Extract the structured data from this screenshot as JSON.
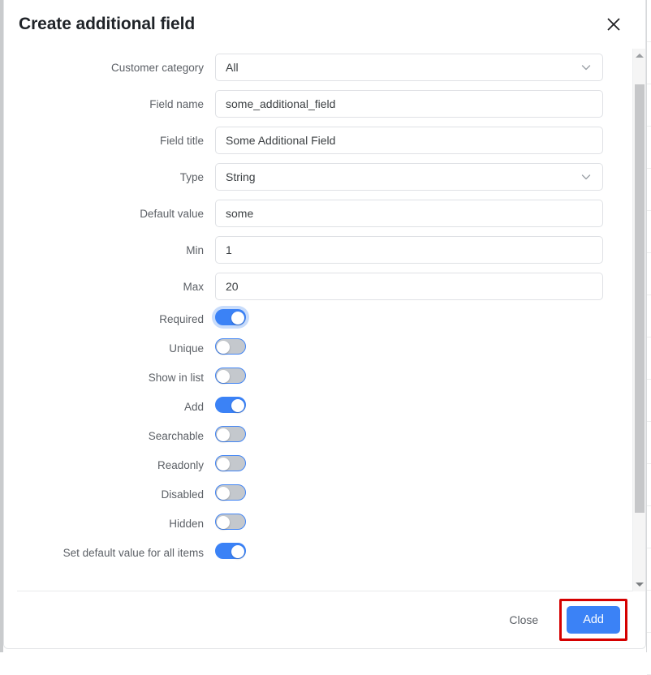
{
  "dialog": {
    "title": "Create additional field",
    "close_icon": "close-icon"
  },
  "form": {
    "rows": [
      {
        "label": "Customer category",
        "type": "select",
        "value": "All"
      },
      {
        "label": "Field name",
        "type": "text",
        "value": "some_additional_field"
      },
      {
        "label": "Field title",
        "type": "text",
        "value": "Some Additional Field"
      },
      {
        "label": "Type",
        "type": "select",
        "value": "String"
      },
      {
        "label": "Default value",
        "type": "text",
        "value": "some"
      },
      {
        "label": "Min",
        "type": "text",
        "value": "1"
      },
      {
        "label": "Max",
        "type": "text",
        "value": "20"
      },
      {
        "label": "Required",
        "type": "toggle",
        "state": "on",
        "focused": true
      },
      {
        "label": "Unique",
        "type": "toggle",
        "state": "off",
        "focused": false
      },
      {
        "label": "Show in list",
        "type": "toggle",
        "state": "off",
        "focused": false
      },
      {
        "label": "Add",
        "type": "toggle",
        "state": "on",
        "focused": false
      },
      {
        "label": "Searchable",
        "type": "toggle",
        "state": "off",
        "focused": false
      },
      {
        "label": "Readonly",
        "type": "toggle",
        "state": "off",
        "focused": false
      },
      {
        "label": "Disabled",
        "type": "toggle",
        "state": "off",
        "focused": false
      },
      {
        "label": "Hidden",
        "type": "toggle",
        "state": "off",
        "focused": false
      },
      {
        "label": "Set default value for all items",
        "type": "toggle",
        "state": "on",
        "focused": false
      }
    ]
  },
  "footer": {
    "close_label": "Close",
    "add_label": "Add",
    "add_highlight_color": "#d50000",
    "add_button_color": "#3b82f6"
  },
  "scrollbar": {
    "thumb_top_pct": 4,
    "thumb_height_pct": 79
  }
}
